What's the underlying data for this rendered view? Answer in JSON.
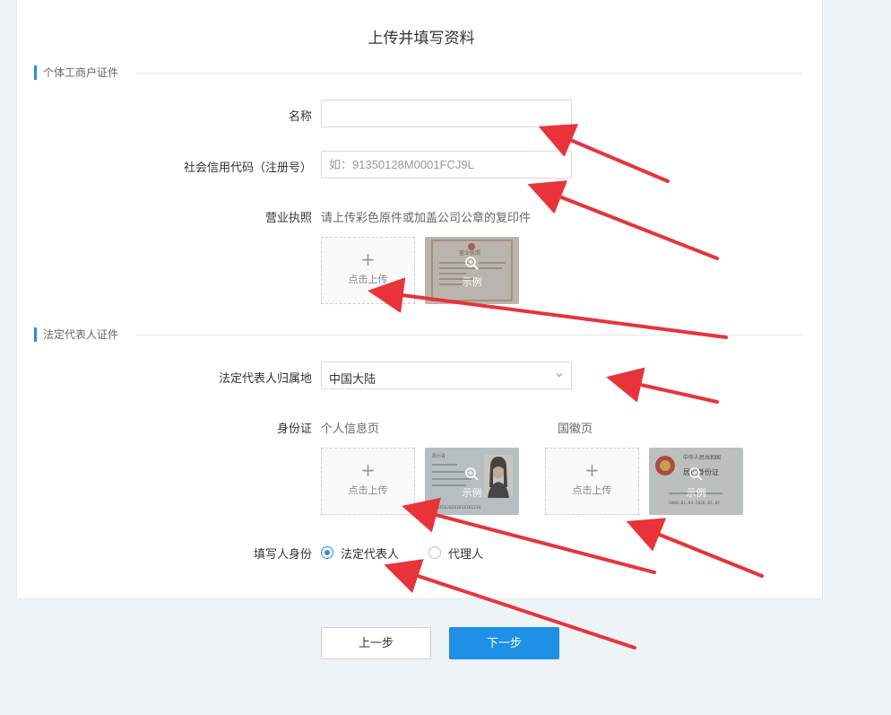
{
  "page_title": "上传并填写资料",
  "sections": {
    "business_license_cert": "个体工商户证件",
    "legal_rep_cert": "法定代表人证件"
  },
  "fields": {
    "name": {
      "label": "名称",
      "value": "",
      "placeholder": ""
    },
    "credit_code": {
      "label": "社会信用代码（注册号）",
      "value": "",
      "placeholder": "如：91350128M0001FCJ9L"
    },
    "business_license": {
      "label": "营业执照",
      "hint": "请上传彩色原件或加盖公司公章的复印件"
    },
    "legal_rep_region": {
      "label": "法定代表人归属地",
      "selected": "中国大陆"
    },
    "id_card": {
      "label": "身份证",
      "front_label": "个人信息页",
      "back_label": "国徽页"
    },
    "filler_identity": {
      "label": "填写人身份",
      "options": [
        "法定代表人",
        "代理人"
      ],
      "selected_index": 0
    }
  },
  "upload": {
    "plus": "+",
    "text": "点击上传"
  },
  "sample": {
    "caption": "示例"
  },
  "sample_images": {
    "license_header": "营业执照",
    "id_name": "周小青",
    "id_number": "12345620201818181234",
    "emblem_title": "中华人民共和国",
    "emblem_subtitle": "居民身份证",
    "emblem_date": "2008.01.04-2028.01.04"
  },
  "buttons": {
    "prev": "上一步",
    "next": "下一步"
  },
  "colors": {
    "accent": "#1e90e6",
    "section_bar": "#2b8cdb",
    "arrow": "#e8333a"
  }
}
